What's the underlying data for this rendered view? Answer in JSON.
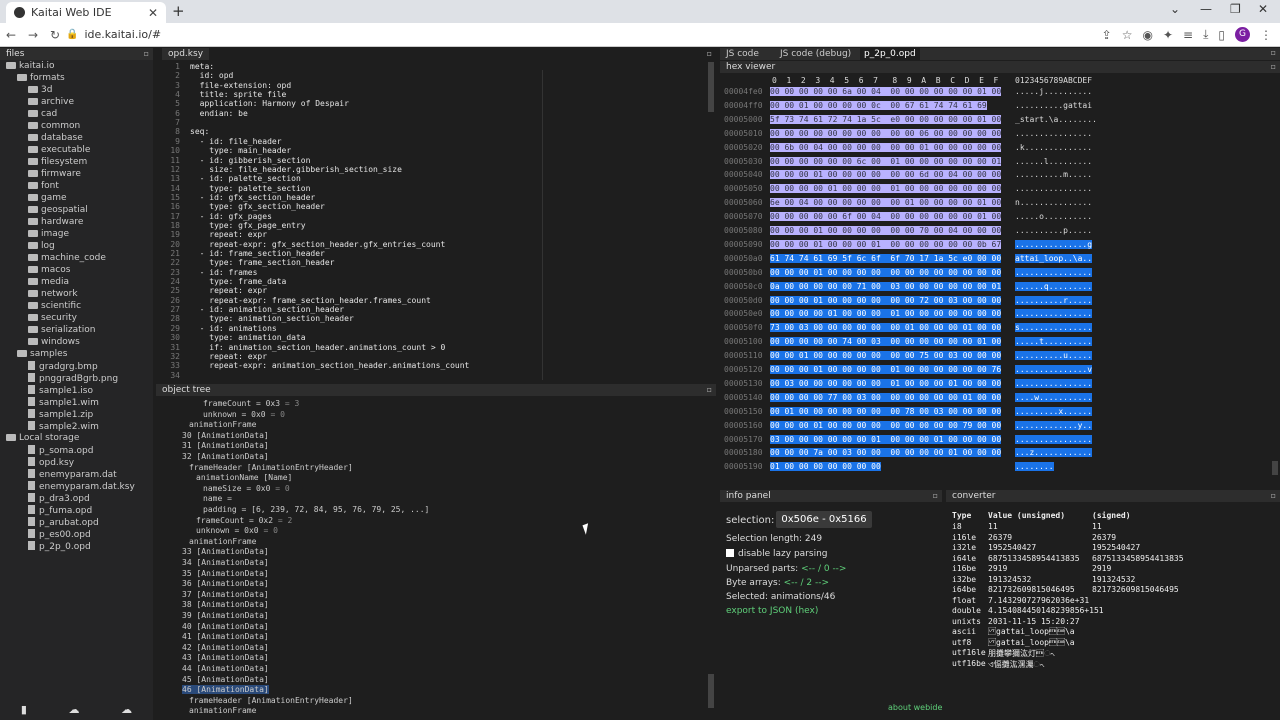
{
  "browser": {
    "tab_title": "Kaitai Web IDE",
    "url": "ide.kaitai.io/#",
    "profile_initial": "G"
  },
  "files_panel": {
    "title": "files",
    "root": "kaitai.io",
    "items": [
      {
        "label": "formats",
        "depth": 1,
        "kind": "folder"
      },
      {
        "label": "3d",
        "depth": 2,
        "kind": "folder"
      },
      {
        "label": "archive",
        "depth": 2,
        "kind": "folder"
      },
      {
        "label": "cad",
        "depth": 2,
        "kind": "folder"
      },
      {
        "label": "common",
        "depth": 2,
        "kind": "folder"
      },
      {
        "label": "database",
        "depth": 2,
        "kind": "folder"
      },
      {
        "label": "executable",
        "depth": 2,
        "kind": "folder"
      },
      {
        "label": "filesystem",
        "depth": 2,
        "kind": "folder"
      },
      {
        "label": "firmware",
        "depth": 2,
        "kind": "folder"
      },
      {
        "label": "font",
        "depth": 2,
        "kind": "folder"
      },
      {
        "label": "game",
        "depth": 2,
        "kind": "folder"
      },
      {
        "label": "geospatial",
        "depth": 2,
        "kind": "folder"
      },
      {
        "label": "hardware",
        "depth": 2,
        "kind": "folder"
      },
      {
        "label": "image",
        "depth": 2,
        "kind": "folder"
      },
      {
        "label": "log",
        "depth": 2,
        "kind": "folder"
      },
      {
        "label": "machine_code",
        "depth": 2,
        "kind": "folder"
      },
      {
        "label": "macos",
        "depth": 2,
        "kind": "folder"
      },
      {
        "label": "media",
        "depth": 2,
        "kind": "folder"
      },
      {
        "label": "network",
        "depth": 2,
        "kind": "folder"
      },
      {
        "label": "scientific",
        "depth": 2,
        "kind": "folder"
      },
      {
        "label": "security",
        "depth": 2,
        "kind": "folder"
      },
      {
        "label": "serialization",
        "depth": 2,
        "kind": "folder"
      },
      {
        "label": "windows",
        "depth": 2,
        "kind": "folder"
      },
      {
        "label": "samples",
        "depth": 1,
        "kind": "folder"
      },
      {
        "label": "gradgrg.bmp",
        "depth": 2,
        "kind": "file"
      },
      {
        "label": "pnggradBgrb.png",
        "depth": 2,
        "kind": "file"
      },
      {
        "label": "sample1.iso",
        "depth": 2,
        "kind": "file"
      },
      {
        "label": "sample1.wim",
        "depth": 2,
        "kind": "file"
      },
      {
        "label": "sample1.zip",
        "depth": 2,
        "kind": "file"
      },
      {
        "label": "sample2.wim",
        "depth": 2,
        "kind": "file"
      },
      {
        "label": "Local storage",
        "depth": 0,
        "kind": "folder"
      },
      {
        "label": "p_soma.opd",
        "depth": 2,
        "kind": "file"
      },
      {
        "label": "opd.ksy",
        "depth": 2,
        "kind": "file"
      },
      {
        "label": "enemyparam.dat",
        "depth": 2,
        "kind": "file"
      },
      {
        "label": "enemyparam.dat.ksy",
        "depth": 2,
        "kind": "file"
      },
      {
        "label": "p_dra3.opd",
        "depth": 2,
        "kind": "file"
      },
      {
        "label": "p_fuma.opd",
        "depth": 2,
        "kind": "file"
      },
      {
        "label": "p_arubat.opd",
        "depth": 2,
        "kind": "file"
      },
      {
        "label": "p_es00.opd",
        "depth": 2,
        "kind": "file"
      },
      {
        "label": "p_2p_0.opd",
        "depth": 2,
        "kind": "file"
      }
    ]
  },
  "editor": {
    "title": "opd.ksy",
    "lines": [
      "meta:",
      "  id: opd",
      "  file-extension: opd",
      "  title: sprite file",
      "  application: Harmony of Despair",
      "  endian: be",
      "",
      "seq:",
      "  - id: file_header",
      "    type: main_header",
      "  - id: gibberish_section",
      "    size: file_header.gibberish_section_size",
      "  - id: palette_section",
      "    type: palette_section",
      "  - id: gfx_section_header",
      "    type: gfx_section_header",
      "  - id: gfx_pages",
      "    type: gfx_page_entry",
      "    repeat: expr",
      "    repeat-expr: gfx_section_header.gfx_entries_count",
      "  - id: frame_section_header",
      "    type: frame_section_header",
      "  - id: frames",
      "    type: frame_data",
      "    repeat: expr",
      "    repeat-expr: frame_section_header.frames_count",
      "  - id: animation_section_header",
      "    type: animation_section_header",
      "  - id: animations",
      "    type: animation_data",
      "    if: animation_section_header.animations_count > 0",
      "    repeat: expr",
      "    repeat-expr: animation_section_header.animations_count",
      ""
    ]
  },
  "object_tree": {
    "title": "object tree",
    "rows": [
      {
        "indent": 5,
        "text": "frameCount = 0x3",
        "dim": " = 3"
      },
      {
        "indent": 5,
        "text": "unknown = 0x0",
        "dim": " = 0"
      },
      {
        "indent": 3,
        "text": "animationFrame",
        "dim": ""
      },
      {
        "indent": 2,
        "text": "30 [AnimationData]",
        "dim": ""
      },
      {
        "indent": 2,
        "text": "31 [AnimationData]",
        "dim": ""
      },
      {
        "indent": 2,
        "text": "32 [AnimationData]",
        "dim": ""
      },
      {
        "indent": 3,
        "text": "frameHeader [AnimationEntryHeader]",
        "dim": ""
      },
      {
        "indent": 4,
        "text": "animationName [Name]",
        "dim": ""
      },
      {
        "indent": 5,
        "text": "nameSize = 0x0",
        "dim": " = 0"
      },
      {
        "indent": 5,
        "text": "name =",
        "dim": ""
      },
      {
        "indent": 5,
        "text": "padding = [6, 239, 72, 84, 95, 76, 79, 25, ...]",
        "dim": ""
      },
      {
        "indent": 4,
        "text": "frameCount = 0x2",
        "dim": " = 2"
      },
      {
        "indent": 4,
        "text": "unknown = 0x0",
        "dim": " = 0"
      },
      {
        "indent": 3,
        "text": "animationFrame",
        "dim": ""
      },
      {
        "indent": 2,
        "text": "33 [AnimationData]",
        "dim": ""
      },
      {
        "indent": 2,
        "text": "34 [AnimationData]",
        "dim": ""
      },
      {
        "indent": 2,
        "text": "35 [AnimationData]",
        "dim": ""
      },
      {
        "indent": 2,
        "text": "36 [AnimationData]",
        "dim": ""
      },
      {
        "indent": 2,
        "text": "37 [AnimationData]",
        "dim": ""
      },
      {
        "indent": 2,
        "text": "38 [AnimationData]",
        "dim": ""
      },
      {
        "indent": 2,
        "text": "39 [AnimationData]",
        "dim": ""
      },
      {
        "indent": 2,
        "text": "40 [AnimationData]",
        "dim": ""
      },
      {
        "indent": 2,
        "text": "41 [AnimationData]",
        "dim": ""
      },
      {
        "indent": 2,
        "text": "42 [AnimationData]",
        "dim": ""
      },
      {
        "indent": 2,
        "text": "43 [AnimationData]",
        "dim": ""
      },
      {
        "indent": 2,
        "text": "44 [AnimationData]",
        "dim": ""
      },
      {
        "indent": 2,
        "text": "45 [AnimationData]",
        "dim": ""
      },
      {
        "indent": 2,
        "text": "46 [AnimationData]",
        "dim": "",
        "selected": true
      },
      {
        "indent": 3,
        "text": "frameHeader [AnimationEntryHeader]",
        "dim": ""
      },
      {
        "indent": 3,
        "text": "animationFrame",
        "dim": ""
      }
    ]
  },
  "right_tabs": [
    "JS code",
    "JS code (debug)",
    "p_2p_0.opd"
  ],
  "hex_viewer": {
    "title": "hex viewer",
    "header_cols": "0  1  2  3  4  5  6  7   8  9  A  B  C  D  E  F",
    "header_ascii": "0123456789ABCDEF",
    "rows": [
      {
        "off": "00004fe0",
        "bytes": "00 00 00 00 00 6a 00 04  00 00 00 00 00 00 01 00",
        "ascii": ".....j..........",
        "sel": 1
      },
      {
        "off": "00004ff0",
        "bytes": "00 00 01 00 00 00 00 0c  00 67 61 74 74 61 69",
        "ascii": "..........gattai",
        "sel": 1
      },
      {
        "off": "00005000",
        "bytes": "5f 73 74 61 72 74 1a 5c  e0 00 00 00 00 00 01 00",
        "ascii": "_start.\\a........",
        "sel": 1
      },
      {
        "off": "00005010",
        "bytes": "00 00 00 00 00 00 00 00  00 00 06 00 00 00 00 00",
        "ascii": "................",
        "sel": 1
      },
      {
        "off": "00005020",
        "bytes": "00 6b 00 04 00 00 00 00  00 00 01 00 00 00 00 00",
        "ascii": ".k..............",
        "sel": 1
      },
      {
        "off": "00005030",
        "bytes": "00 00 00 00 00 00 6c 00  01 00 00 00 00 00 00 01",
        "ascii": "......l.........",
        "sel": 1
      },
      {
        "off": "00005040",
        "bytes": "00 00 00 01 00 00 00 00  00 00 6d 00 04 00 00 00",
        "ascii": "..........m.....",
        "sel": 1
      },
      {
        "off": "00005050",
        "bytes": "00 00 00 00 01 00 00 00  01 00 00 00 00 00 00 00",
        "ascii": "................",
        "sel": 1
      },
      {
        "off": "00005060",
        "bytes": "6e 00 04 00 00 00 00 00  00 01 00 00 00 00 01 00",
        "ascii": "n...............",
        "sel": 1
      },
      {
        "off": "00005070",
        "bytes": "00 00 00 00 00 6f 00 04  00 00 00 00 00 00 01 00",
        "ascii": ".....o..........",
        "sel": 1
      },
      {
        "off": "00005080",
        "bytes": "00 00 00 01 00 00 00 00  00 00 70 00 04 00 00 00",
        "ascii": "..........p.....",
        "sel": 1
      },
      {
        "off": "00005090",
        "bytes": "00 00 00 01 00 00 00 01  00 00 00 00 00 00 0b 67",
        "ascii": "...............g",
        "sel": 3
      },
      {
        "off": "000050a0",
        "bytes": "61 74 74 61 69 5f 6c 6f  6f 70 17 1a 5c e0 00 00",
        "ascii": "attai_loop..\\a..",
        "sel": 2
      },
      {
        "off": "000050b0",
        "bytes": "00 00 00 01 00 00 00 00  00 00 00 00 00 00 00 00",
        "ascii": "................",
        "sel": 2
      },
      {
        "off": "000050c0",
        "bytes": "0a 00 00 00 00 00 71 00  03 00 00 00 00 00 00 01",
        "ascii": "......q.........",
        "sel": 2
      },
      {
        "off": "000050d0",
        "bytes": "00 00 00 01 00 00 00 00  00 00 72 00 03 00 00 00",
        "ascii": "..........r.....",
        "sel": 2
      },
      {
        "off": "000050e0",
        "bytes": "00 00 00 00 01 00 00 00  01 00 00 00 00 00 00 00",
        "ascii": "................",
        "sel": 2
      },
      {
        "off": "000050f0",
        "bytes": "73 00 03 00 00 00 00 00  00 01 00 00 00 01 00 00",
        "ascii": "s...............",
        "sel": 2
      },
      {
        "off": "00005100",
        "bytes": "00 00 00 00 00 74 00 03  00 00 00 00 00 00 01 00",
        "ascii": ".....t..........",
        "sel": 2
      },
      {
        "off": "00005110",
        "bytes": "00 00 01 00 00 00 00 00  00 00 75 00 03 00 00 00",
        "ascii": "..........u.....",
        "sel": 2
      },
      {
        "off": "00005120",
        "bytes": "00 00 00 01 00 00 00 00  01 00 00 00 00 00 00 76",
        "ascii": "...............v",
        "sel": 2
      },
      {
        "off": "00005130",
        "bytes": "00 03 00 00 00 00 00 00  01 00 00 00 01 00 00 00",
        "ascii": "................",
        "sel": 2
      },
      {
        "off": "00005140",
        "bytes": "00 00 00 00 77 00 03 00  00 00 00 00 00 01 00 00",
        "ascii": "....w...........",
        "sel": 2
      },
      {
        "off": "00005150",
        "bytes": "00 01 00 00 00 00 00 00  00 78 00 03 00 00 00 00",
        "ascii": ".........x......",
        "sel": 2
      },
      {
        "off": "00005160",
        "bytes": "00 00 00 01 00 00 00 00  00 00 00 00 00 79 00 00",
        "ascii": ".............y..",
        "sel": 2
      },
      {
        "off": "00005170",
        "bytes": "03 00 00 00 00 00 00 01  00 00 00 01 00 00 00 00",
        "ascii": "................",
        "sel": 2
      },
      {
        "off": "00005180",
        "bytes": "00 00 00 7a 00 03 00 00  00 00 00 00 01 00 00 00",
        "ascii": "...z............",
        "sel": 2
      },
      {
        "off": "00005190",
        "bytes": "01 00 00 00 00 00 00 00",
        "ascii": "........",
        "sel": 2
      }
    ]
  },
  "info_panel": {
    "title": "info panel",
    "selection_label": "selection:",
    "selection_value": "0x506e - 0x5166",
    "selection_length": "Selection length: 249",
    "lazy_parsing": "disable lazy parsing",
    "unparsed_label": "Unparsed parts: ",
    "unparsed_value": "<-- / 0 -->",
    "byte_arrays_label": "Byte arrays: ",
    "byte_arrays_value": "<-- / 2 -->",
    "selected": "Selected: animations/46",
    "export": "export to JSON (hex)",
    "about": "about webide"
  },
  "converter": {
    "title": "converter",
    "headers": [
      "Type",
      "Value (unsigned)",
      "(signed)"
    ],
    "rows": [
      [
        "i8",
        "11",
        "11"
      ],
      [
        "i16le",
        "26379",
        "26379"
      ],
      [
        "i32le",
        "1952540427",
        "1952540427"
      ],
      [
        "i64le",
        "6875133458954413835",
        "6875133458954413835"
      ],
      [
        "i16be",
        "2919",
        "2919"
      ],
      [
        "i32be",
        "191324532",
        "191324532"
      ],
      [
        "i64be",
        "821732609815046495",
        "821732609815046495"
      ],
      [
        "float",
        "7.143290727962036e+31",
        ""
      ],
      [
        "double",
        "4.154084450148239856+151",
        ""
      ],
      [
        "unixts",
        "2031-11-15 15:20:27",
        ""
      ],
      [
        "ascii",
        "\u000bgattai_loop\u0017\u001a\\a",
        ""
      ],
      [
        "utf8",
        "\u000bgattai_loop\u0017\u001a\\a",
        ""
      ],
      [
        "utf16le",
        "朋攤攀獮汯灯\u0017ᨚ",
        ""
      ],
      [
        "utf16be",
        "ଏ愊攤汯潶灟ᨚ",
        ""
      ]
    ]
  }
}
